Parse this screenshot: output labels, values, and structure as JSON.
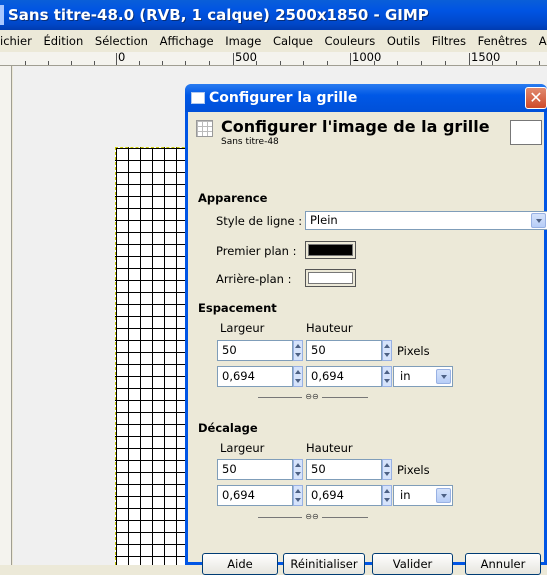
{
  "window": {
    "title": "Sans titre-48.0 (RVB, 1 calque) 2500x1850 - GIMP"
  },
  "menu": [
    "ichier",
    "Édition",
    "Sélection",
    "Affichage",
    "Image",
    "Calque",
    "Couleurs",
    "Outils",
    "Filtres",
    "Fenêtres",
    "A"
  ],
  "ruler": {
    "labels": [
      "0",
      "500",
      "1000",
      "1500"
    ]
  },
  "dialog": {
    "title": "Configurer la grille",
    "header_title": "Configurer l'image de la grille",
    "header_subtitle": "Sans titre-48",
    "appearance": {
      "section": "Apparence",
      "line_style_label": "Style de ligne :",
      "line_style_value": "Plein",
      "foreground_label": "Premier plan :",
      "foreground_color": "#000000",
      "background_label": "Arrière-plan :",
      "background_color": "#ffffff"
    },
    "spacing": {
      "section": "Espacement",
      "width_label": "Largeur",
      "height_label": "Hauteur",
      "width_px": "50",
      "height_px": "50",
      "unit_px": "Pixels",
      "width_in": "0,694",
      "height_in": "0,694",
      "unit_in": "in"
    },
    "offset": {
      "section": "Décalage",
      "width_label": "Largeur",
      "height_label": "Hauteur",
      "width_px": "50",
      "height_px": "50",
      "unit_px": "Pixels",
      "width_in": "0,694",
      "height_in": "0,694",
      "unit_in": "in"
    },
    "buttons": {
      "help": "Aide",
      "reset": "Réinitialiser",
      "ok": "Valider",
      "cancel": "Annuler"
    },
    "icons": {
      "grid": "grid-icon",
      "close": "close-icon",
      "chain": "chain-link-icon"
    }
  },
  "colors": {
    "titlebar": "#0054e3",
    "dialog_bg": "#ece9d8"
  }
}
